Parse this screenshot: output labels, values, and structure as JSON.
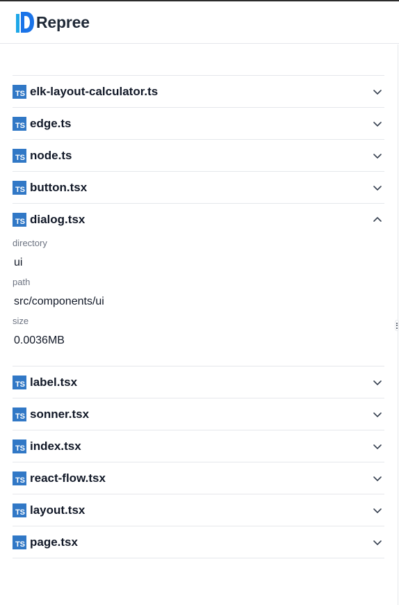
{
  "header": {
    "brand": "Repree",
    "logo_icon": "repree-logo-icon"
  },
  "colors": {
    "ts_icon_bg": "#3178c6",
    "divider": "#e5e7eb",
    "text": "#111827",
    "muted": "#6b7280"
  },
  "file_icon": {
    "name": "typescript-file-icon",
    "text": "TS"
  },
  "files": [
    {
      "name": "elk-layout-calculator.ts",
      "expanded": false
    },
    {
      "name": "edge.ts",
      "expanded": false
    },
    {
      "name": "node.ts",
      "expanded": false
    },
    {
      "name": "button.tsx",
      "expanded": false
    },
    {
      "name": "dialog.tsx",
      "expanded": true,
      "details": [
        {
          "label": "directory",
          "value": "ui"
        },
        {
          "label": "path",
          "value": "src/components/ui"
        },
        {
          "label": "size",
          "value": "0.0036MB"
        }
      ]
    },
    {
      "name": "label.tsx",
      "expanded": false
    },
    {
      "name": "sonner.tsx",
      "expanded": false
    },
    {
      "name": "index.tsx",
      "expanded": false
    },
    {
      "name": "react-flow.tsx",
      "expanded": false
    },
    {
      "name": "layout.tsx",
      "expanded": false
    },
    {
      "name": "page.tsx",
      "expanded": false
    }
  ]
}
